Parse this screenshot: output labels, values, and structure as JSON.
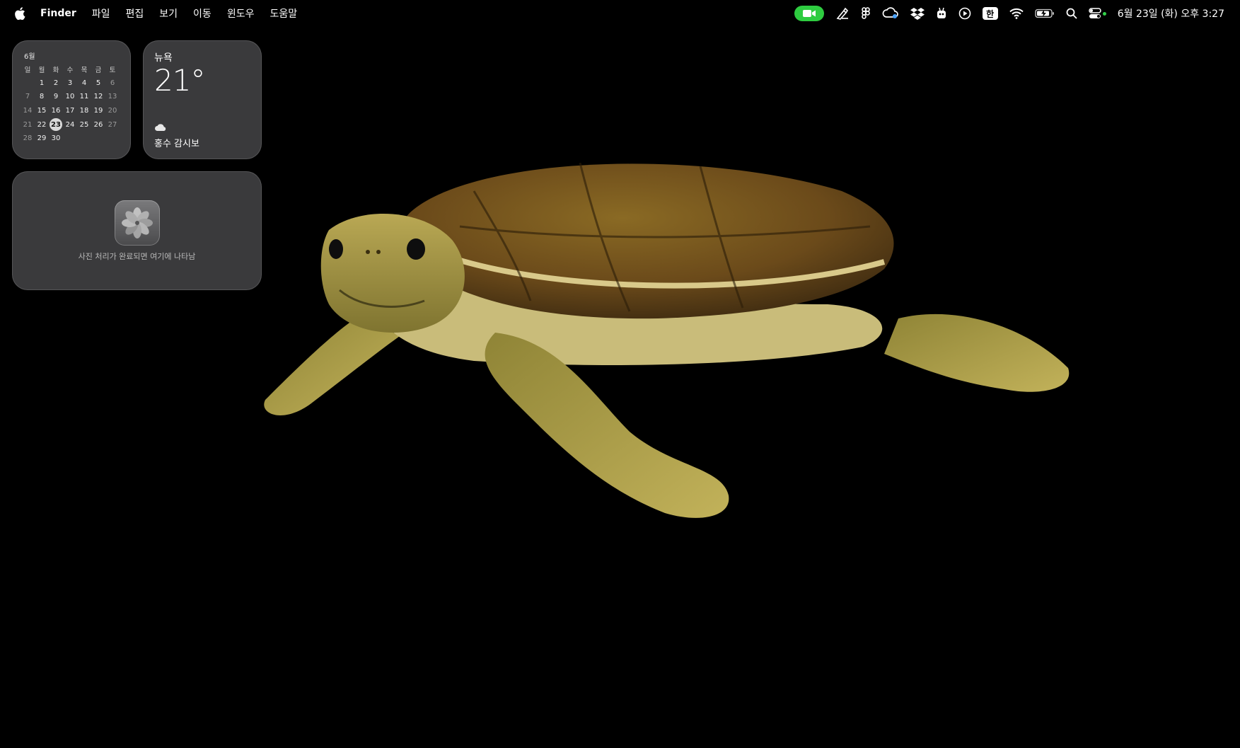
{
  "menubar": {
    "app_name": "Finder",
    "menus": [
      "파일",
      "편집",
      "보기",
      "이동",
      "윈도우",
      "도움말"
    ],
    "status_icons": [
      "facetime-video-icon",
      "pen-icon",
      "figma-icon",
      "cloud-sync-icon",
      "dropbox-icon",
      "bot-icon",
      "play-circle-icon",
      "korean-input-icon",
      "wifi-icon",
      "battery-charging-icon",
      "search-icon",
      "control-center-icon"
    ],
    "input_source": "한",
    "clock": "6월 23일 (화) 오후 3:27",
    "facetime_color": "#2ecc40"
  },
  "calendar": {
    "month": "6월",
    "weekdays": [
      "일",
      "월",
      "화",
      "수",
      "목",
      "금",
      "토"
    ],
    "weeks": [
      [
        "",
        "1",
        "2",
        "3",
        "4",
        "5",
        "6"
      ],
      [
        "7",
        "8",
        "9",
        "10",
        "11",
        "12",
        "13"
      ],
      [
        "14",
        "15",
        "16",
        "17",
        "18",
        "19",
        "20"
      ],
      [
        "21",
        "22",
        "23",
        "24",
        "25",
        "26",
        "27"
      ],
      [
        "28",
        "29",
        "30",
        "",
        "",
        "",
        ""
      ]
    ],
    "today": "23"
  },
  "weather": {
    "city": "뉴욕",
    "temperature": "21°",
    "condition_icon": "cloud-icon",
    "condition": "홍수 감시보"
  },
  "photos_widget": {
    "app_icon": "photos-app-icon",
    "message": "사진 처리가 완료되면 여기에 나타남"
  },
  "wallpaper": {
    "subject": "sea-turtle",
    "background": "#000000"
  }
}
